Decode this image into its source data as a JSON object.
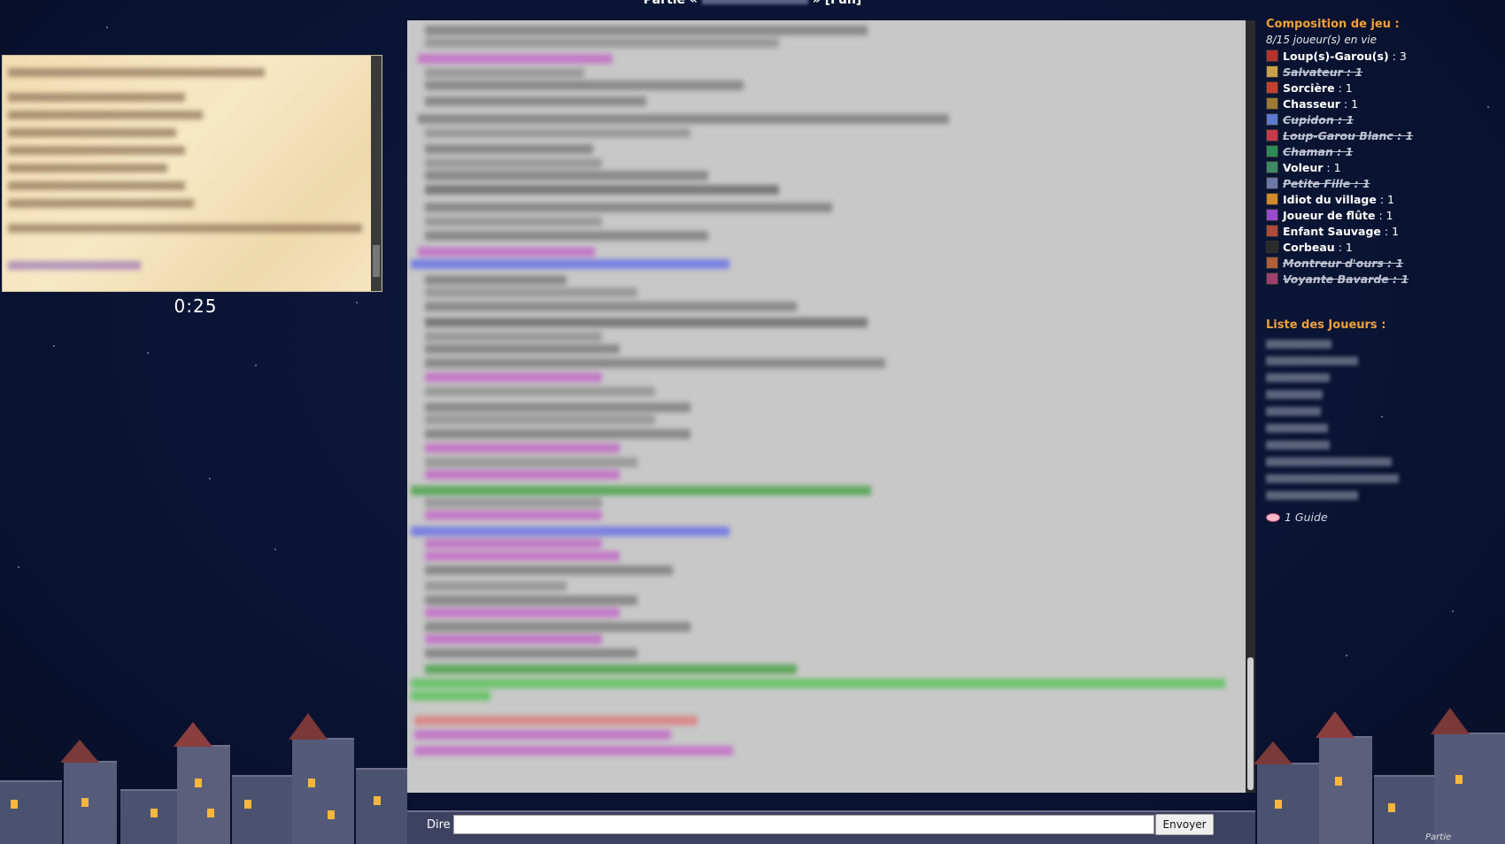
{
  "header": {
    "title_prefix": "Partie «",
    "title_suffix": "» [Fun]"
  },
  "timer": "0:25",
  "composition": {
    "title": "Composition de jeu :",
    "alive": "8/15 joueur(s) en vie",
    "roles": [
      {
        "name": "Loup(s)-Garou(s)",
        "count": " : 3",
        "dead": false,
        "color": "#b8322c"
      },
      {
        "name": "Salvateur : 1",
        "count": "",
        "dead": true,
        "color": "#c9a04a"
      },
      {
        "name": "Sorcière",
        "count": " : 1",
        "dead": false,
        "color": "#c4402f"
      },
      {
        "name": "Chasseur",
        "count": " : 1",
        "dead": false,
        "color": "#9b7a32"
      },
      {
        "name": "Cupidon : 1",
        "count": "",
        "dead": true,
        "color": "#5b7bd0"
      },
      {
        "name": "Loup-Garou Blanc : 1",
        "count": "",
        "dead": true,
        "color": "#c63a4a"
      },
      {
        "name": "Chaman : 1",
        "count": "",
        "dead": true,
        "color": "#2f8a5a"
      },
      {
        "name": "Voleur",
        "count": " : 1",
        "dead": false,
        "color": "#3d8a64"
      },
      {
        "name": "Petite Fille : 1",
        "count": "",
        "dead": true,
        "color": "#6a7aa8"
      },
      {
        "name": "Idiot du village",
        "count": " : 1",
        "dead": false,
        "color": "#d08a2a"
      },
      {
        "name": "Joueur de flûte",
        "count": " : 1",
        "dead": false,
        "color": "#9a4ad0"
      },
      {
        "name": "Enfant Sauvage",
        "count": " : 1",
        "dead": false,
        "color": "#b04a3a"
      },
      {
        "name": "Corbeau",
        "count": " : 1",
        "dead": false,
        "color": "#2a2a2a"
      },
      {
        "name": "Montreur d'ours : 1",
        "count": "",
        "dead": true,
        "color": "#b0603a"
      },
      {
        "name": "Voyante Bavarde : 1",
        "count": "",
        "dead": true,
        "color": "#a04070"
      }
    ]
  },
  "players": {
    "title": "Liste des Joueurs :",
    "guide": "1 Guide"
  },
  "input": {
    "label": "Dire",
    "placeholder": "",
    "send": "Envoyer"
  },
  "footer": "Partie"
}
